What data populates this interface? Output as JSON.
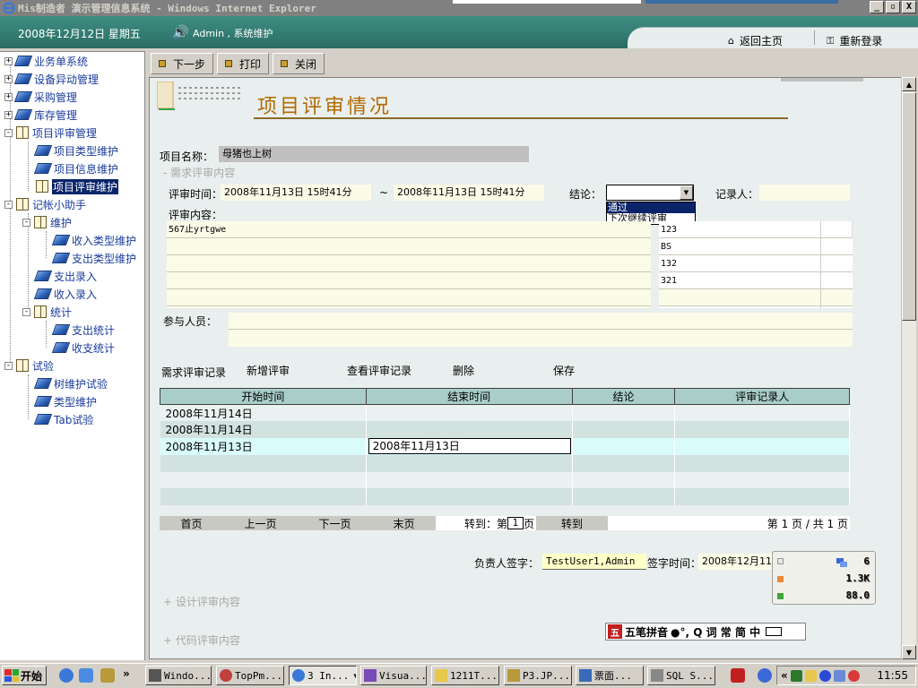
{
  "window": {
    "title": "Mis制造者  演示管理信息系统 - Windows Internet Explorer",
    "controls": [
      "_",
      "▫",
      "X"
    ]
  },
  "header": {
    "date": "2008年12月12日 星期五",
    "user": "Admin , 系统维护",
    "home_label": "返回主页",
    "relogin_label": "重新登录"
  },
  "tree": {
    "nodes": [
      {
        "label": "业务单系统"
      },
      {
        "label": "设备异动管理"
      },
      {
        "label": "采购管理"
      },
      {
        "label": "库存管理"
      },
      {
        "label": "项目评审管理"
      },
      {
        "label": "项目类型维护"
      },
      {
        "label": "项目信息维护"
      },
      {
        "label": "项目评审维护"
      },
      {
        "label": "记帐小助手"
      },
      {
        "label": "维护"
      },
      {
        "label": "收入类型维护"
      },
      {
        "label": "支出类型维护"
      },
      {
        "label": "支出录入"
      },
      {
        "label": "收入录入"
      },
      {
        "label": "统计"
      },
      {
        "label": "支出统计"
      },
      {
        "label": "收支统计"
      },
      {
        "label": "试验"
      },
      {
        "label": "树维护试验"
      },
      {
        "label": "类型维护"
      },
      {
        "label": "Tab试验"
      }
    ]
  },
  "toolbar": {
    "next_label": "下一步",
    "print_label": "打印",
    "close_label": "关闭"
  },
  "page": {
    "title": "项目评审情况",
    "project_name_label": "项目名称：",
    "project_name_value": "母猪也上树",
    "req_review_toggle": "- 需求评审内容",
    "review_time_label": "评审时间：",
    "review_time_start": "2008年11月13日 15时41分",
    "tilde": "~",
    "review_time_end": "2008年11月13日 15时41分",
    "conclusion_label": "结论：",
    "conclusion_options": [
      "通过",
      "下次继续评审"
    ],
    "recorder_label": "记录人：",
    "review_content_label": "评审内容：",
    "review_content_lines": [
      "567止yrtgwe",
      "",
      "",
      "",
      ""
    ],
    "side_list": [
      "123",
      "BS",
      "132",
      "321",
      ""
    ],
    "participants_label": "参与人员：",
    "actions": {
      "records": "需求评审记录",
      "new": "新增评审",
      "view": "查看评审记录",
      "delete": "删除",
      "save": "保存"
    },
    "grid": {
      "columns": [
        "开始时间",
        "结束时间",
        "结论",
        "评审记录人"
      ],
      "rows": [
        [
          "2008年11月14日",
          "",
          "",
          ""
        ],
        [
          "2008年11月14日",
          "",
          "",
          ""
        ],
        [
          "2008年11月13日",
          "2008年11月13日",
          "",
          ""
        ],
        [
          "",
          "",
          "",
          ""
        ],
        [
          "",
          "",
          "",
          ""
        ],
        [
          "",
          "",
          "",
          ""
        ]
      ]
    },
    "pager": {
      "first": "首页",
      "prev": "上一页",
      "next": "下一页",
      "last": "末页",
      "goto_prefix": "转到：第",
      "page_input": "1",
      "goto_suffix": "页",
      "goto_button": "转到",
      "summary": "第 1 页 / 共 1 页"
    },
    "sign_label": "负责人签字：",
    "sign_value": "TestUser1,Admin",
    "sign_time_label": "签字时间：",
    "sign_time_value": "2008年12月11日 16时32分",
    "design_review_toggle": "+ 设计评审内容",
    "code_review_toggle": "+ 代码评审内容"
  },
  "net_widget": {
    "values": [
      "6",
      "1.3K",
      "88.0"
    ]
  },
  "ime": {
    "label": "五笔拼音",
    "keys": "●°, Q 词 常 简 中"
  },
  "taskbar": {
    "start_label": "开始",
    "chevron": "»",
    "tasks": [
      "Windo...",
      "TopPm...",
      "3 In...",
      "Visua...",
      "1211T...",
      "P3.JP...",
      "票面...",
      "SQL S..."
    ],
    "tray_chevron": "«",
    "clock": "11:55"
  },
  "colors": {
    "header_green": "#2f7a71",
    "title_orange": "#b26a00",
    "tree_text": "#1a3b9c",
    "selection": "#0a246a"
  }
}
